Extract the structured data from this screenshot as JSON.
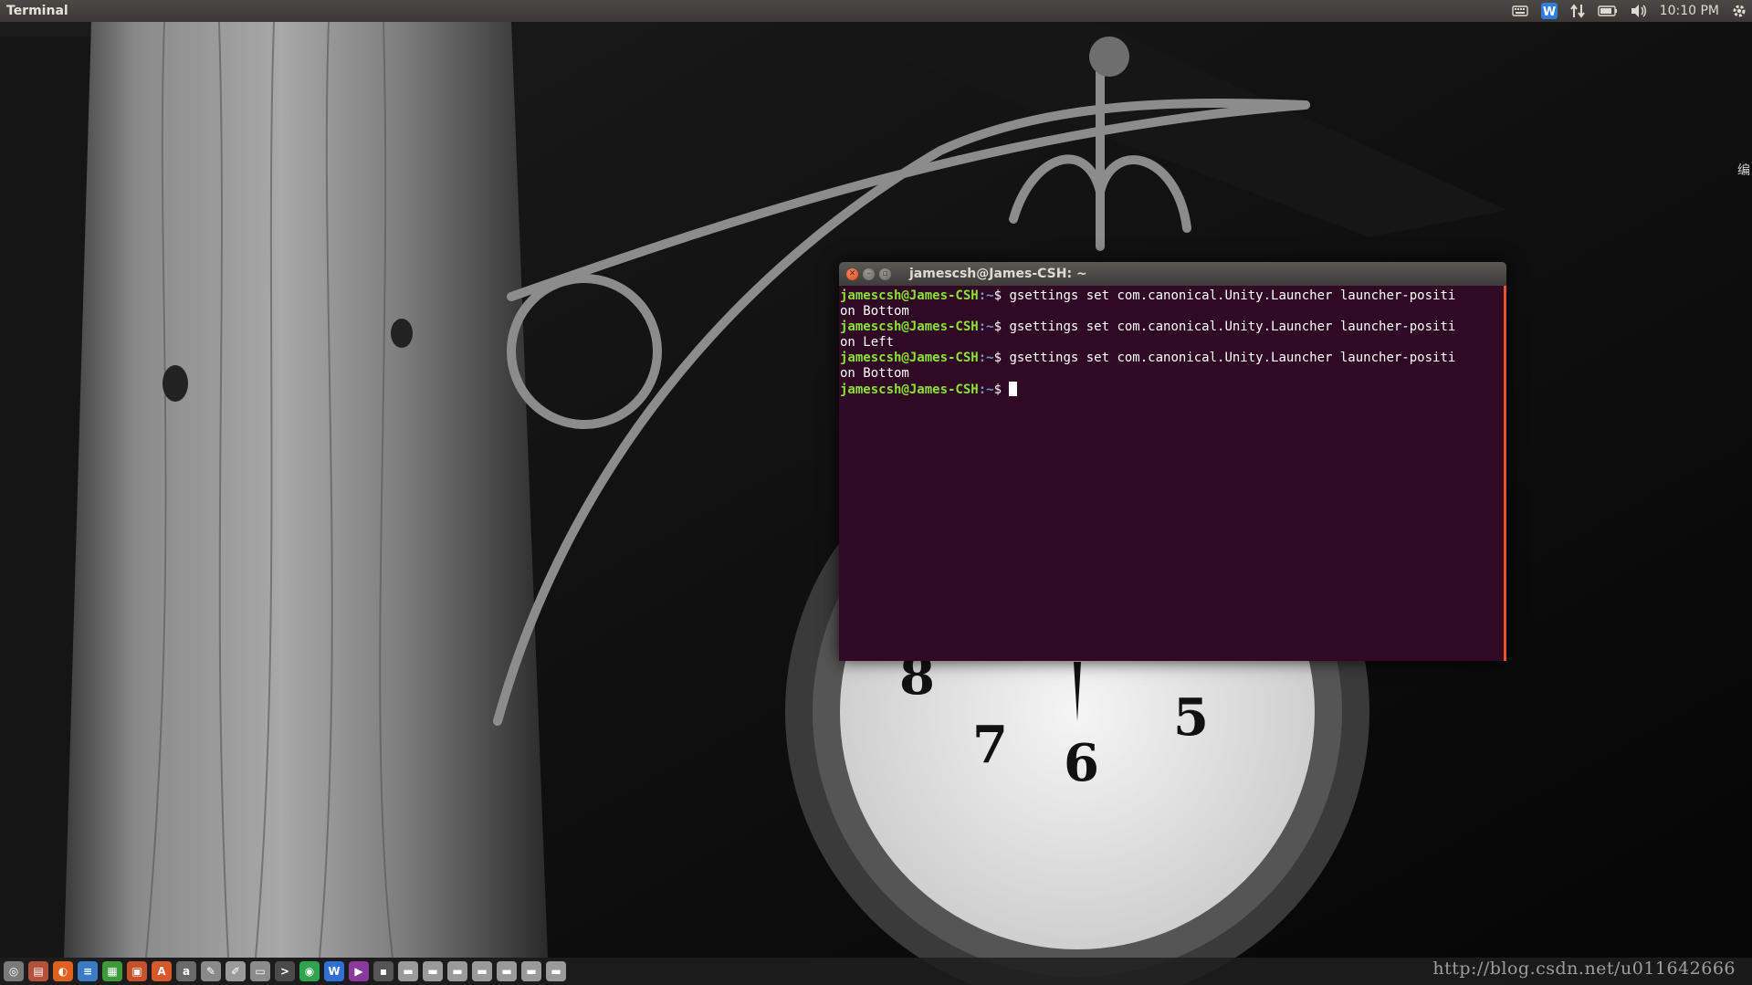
{
  "top_panel": {
    "app_title": "Terminal",
    "clock": "10:10 PM",
    "tray_icons": [
      "keyboard-icon",
      "wps-icon",
      "network-icon",
      "battery-icon",
      "volume-icon",
      "gear-icon"
    ]
  },
  "terminal": {
    "window_title": "jamescsh@James-CSH: ~",
    "prompt_user": "jamescsh@James-CSH",
    "prompt_path": ":~",
    "prompt_symbol": "$ ",
    "lines": [
      {
        "cmd": "gsettings set com.canonical.Unity.Launcher launcher-positi",
        "wrap": "on Bottom"
      },
      {
        "cmd": "gsettings set com.canonical.Unity.Launcher launcher-positi",
        "wrap": "on Left"
      },
      {
        "cmd": "gsettings set com.canonical.Unity.Launcher launcher-positi",
        "wrap": "on Bottom"
      }
    ]
  },
  "launcher": {
    "apps": [
      {
        "name": "dash-icon",
        "color": "#7a7a7a",
        "glyph": "◎"
      },
      {
        "name": "files-icon",
        "color": "#b5503a",
        "glyph": "▤"
      },
      {
        "name": "firefox-icon",
        "color": "#e0601e",
        "glyph": "◐"
      },
      {
        "name": "writer-icon",
        "color": "#3a7bc8",
        "glyph": "≡"
      },
      {
        "name": "calc-icon",
        "color": "#3c9a3c",
        "glyph": "▦"
      },
      {
        "name": "impress-icon",
        "color": "#c8502a",
        "glyph": "▣"
      },
      {
        "name": "software-center-icon",
        "color": "#d9582a",
        "glyph": "A"
      },
      {
        "name": "amazon-icon",
        "color": "#6a6a6a",
        "glyph": "a"
      },
      {
        "name": "system-settings-icon",
        "color": "#8a8a8a",
        "glyph": "✎"
      },
      {
        "name": "text-editor-icon",
        "color": "#9a9a9a",
        "glyph": "✐"
      },
      {
        "name": "printer-icon",
        "color": "#8c8c8c",
        "glyph": "▭"
      },
      {
        "name": "terminal-icon",
        "color": "#4a4a4a",
        "glyph": ">"
      },
      {
        "name": "wechat-icon",
        "color": "#2ea44f",
        "glyph": "◉"
      },
      {
        "name": "wps-writer-icon",
        "color": "#2f6fd8",
        "glyph": "W"
      },
      {
        "name": "video-icon",
        "color": "#8a3a9a",
        "glyph": "▶"
      },
      {
        "name": "unknown-app-icon",
        "color": "#555555",
        "glyph": "▪"
      },
      {
        "name": "drive-icon",
        "color": "#9a9a9a",
        "glyph": "▬"
      },
      {
        "name": "drive-icon",
        "color": "#9a9a9a",
        "glyph": "▬"
      },
      {
        "name": "drive-icon",
        "color": "#9a9a9a",
        "glyph": "▬"
      },
      {
        "name": "drive-icon",
        "color": "#9a9a9a",
        "glyph": "▬"
      },
      {
        "name": "drive-icon",
        "color": "#9a9a9a",
        "glyph": "▬"
      },
      {
        "name": "drive-icon",
        "color": "#9a9a9a",
        "glyph": "▬"
      },
      {
        "name": "drive-icon",
        "color": "#9a9a9a",
        "glyph": "▬"
      }
    ]
  },
  "watermark": "http://blog.csdn.net/u011642666",
  "side_glyph": "编",
  "colors": {
    "terminal_bg": "#300a24",
    "prompt_user": "#8ae234",
    "prompt_path": "#729fcf",
    "accent": "#e0562a"
  }
}
